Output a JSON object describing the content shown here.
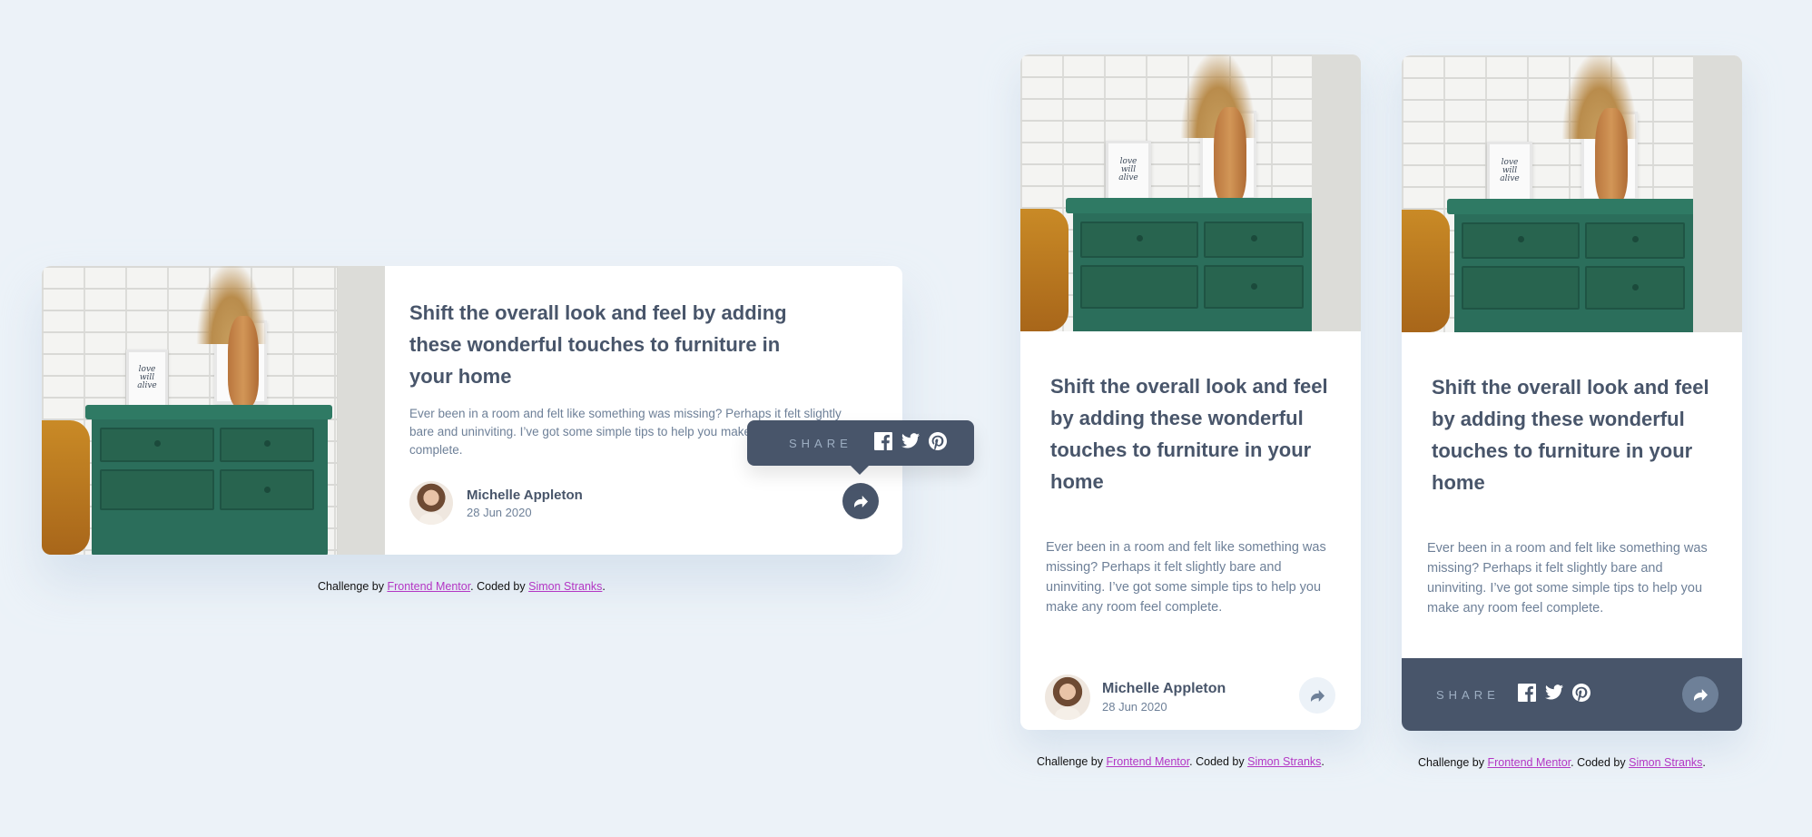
{
  "article": {
    "title": "Shift the overall look and feel by adding these wonderful touches to furniture in your home",
    "description": "Ever been in a room and felt like something was missing? Perhaps it felt slightly bare and uninviting. I’ve got some simple tips to help you make any room feel complete.",
    "author_name": "Michelle Appleton",
    "date": "28 Jun 2020",
    "image_icon": "drawers-photo"
  },
  "share": {
    "label": "SHARE",
    "icons": [
      "facebook-icon",
      "twitter-icon",
      "pinterest-icon"
    ],
    "button_icon": "share-arrow-icon"
  },
  "credit": {
    "prefix": "Challenge by ",
    "link1": "Frontend Mentor",
    "middle": ". Coded by ",
    "link2": "Simon Stranks",
    "suffix": "."
  },
  "colors": {
    "background": "#ecf2f8",
    "dark_slate": "#48556a",
    "grayish_blue": "#6e8098",
    "light_grayish_blue": "#ecf2f8",
    "link": "#b336c4"
  }
}
